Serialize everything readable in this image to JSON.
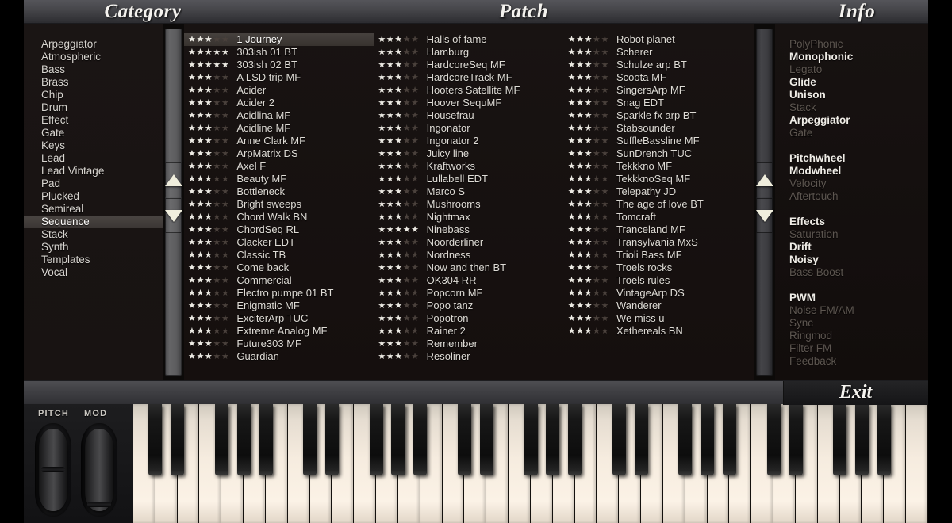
{
  "headers": {
    "category": "Category",
    "patch": "Patch",
    "info": "Info"
  },
  "categories": {
    "selected": "Sequence",
    "items": [
      "Arpeggiator",
      "Atmospheric",
      "Bass",
      "Brass",
      "Chip",
      "Drum",
      "Effect",
      "Gate",
      "Keys",
      "Lead",
      "Lead Vintage",
      "Pad",
      "Plucked",
      "Semireal",
      "Sequence",
      "Stack",
      "Synth",
      "Templates",
      "Vocal"
    ]
  },
  "patches": {
    "selected": "1 Journey",
    "max_stars": 5,
    "columns": [
      [
        {
          "name": "1 Journey",
          "stars": 3
        },
        {
          "name": "303ish 01 BT",
          "stars": 5
        },
        {
          "name": "303ish 02 BT",
          "stars": 5
        },
        {
          "name": "A LSD trip MF",
          "stars": 3
        },
        {
          "name": "Acider",
          "stars": 3
        },
        {
          "name": "Acider 2",
          "stars": 3
        },
        {
          "name": "Acidlina MF",
          "stars": 3
        },
        {
          "name": "Acidline MF",
          "stars": 3
        },
        {
          "name": "Anne Clark MF",
          "stars": 3
        },
        {
          "name": "ArpMatrix DS",
          "stars": 3
        },
        {
          "name": "Axel F",
          "stars": 3
        },
        {
          "name": "Beauty MF",
          "stars": 3
        },
        {
          "name": "Bottleneck",
          "stars": 3
        },
        {
          "name": "Bright sweeps",
          "stars": 3
        },
        {
          "name": "Chord Walk BN",
          "stars": 3
        },
        {
          "name": "ChordSeq RL",
          "stars": 3
        },
        {
          "name": "Clacker EDT",
          "stars": 3
        },
        {
          "name": "Classic TB",
          "stars": 3
        },
        {
          "name": "Come back",
          "stars": 3
        },
        {
          "name": "Commercial",
          "stars": 3
        },
        {
          "name": "Electro pumpe 01 BT",
          "stars": 3
        },
        {
          "name": "Enigmatic MF",
          "stars": 3
        },
        {
          "name": "ExciterArp TUC",
          "stars": 3
        },
        {
          "name": "Extreme Analog MF",
          "stars": 3
        },
        {
          "name": "Future303 MF",
          "stars": 3
        },
        {
          "name": "Guardian",
          "stars": 3
        }
      ],
      [
        {
          "name": "Halls of fame",
          "stars": 3
        },
        {
          "name": "Hamburg",
          "stars": 3
        },
        {
          "name": "HardcoreSeq MF",
          "stars": 3
        },
        {
          "name": "HardcoreTrack MF",
          "stars": 3
        },
        {
          "name": "Hooters Satellite MF",
          "stars": 3
        },
        {
          "name": "Hoover SequMF",
          "stars": 3
        },
        {
          "name": "Housefrau",
          "stars": 3
        },
        {
          "name": "Ingonator",
          "stars": 3
        },
        {
          "name": "Ingonator 2",
          "stars": 3
        },
        {
          "name": "Juicy line",
          "stars": 3
        },
        {
          "name": "Kraftworks",
          "stars": 3
        },
        {
          "name": "Lullabell EDT",
          "stars": 3
        },
        {
          "name": "Marco S",
          "stars": 3
        },
        {
          "name": "Mushrooms",
          "stars": 3
        },
        {
          "name": "Nightmax",
          "stars": 3
        },
        {
          "name": "Ninebass",
          "stars": 5
        },
        {
          "name": "Noorderliner",
          "stars": 3
        },
        {
          "name": "Nordness",
          "stars": 3
        },
        {
          "name": "Now and then BT",
          "stars": 3
        },
        {
          "name": "OK304 RR",
          "stars": 3
        },
        {
          "name": "Popcorn MF",
          "stars": 3
        },
        {
          "name": "Popo tanz",
          "stars": 3
        },
        {
          "name": "Popotron",
          "stars": 3
        },
        {
          "name": "Rainer 2",
          "stars": 3
        },
        {
          "name": "Remember",
          "stars": 3
        },
        {
          "name": "Resoliner",
          "stars": 3
        }
      ],
      [
        {
          "name": "Robot planet",
          "stars": 3
        },
        {
          "name": "Scherer",
          "stars": 3
        },
        {
          "name": "Schulze arp BT",
          "stars": 3
        },
        {
          "name": "Scoota MF",
          "stars": 3
        },
        {
          "name": "SingersArp MF",
          "stars": 3
        },
        {
          "name": "Snag EDT",
          "stars": 3
        },
        {
          "name": "Sparkle fx arp BT",
          "stars": 3
        },
        {
          "name": "Stabsounder",
          "stars": 3
        },
        {
          "name": "SuffleBassline MF",
          "stars": 3
        },
        {
          "name": "SunDrench TUC",
          "stars": 3
        },
        {
          "name": "Tekkkno MF",
          "stars": 3
        },
        {
          "name": "TekkknoSeq MF",
          "stars": 3
        },
        {
          "name": "Telepathy JD",
          "stars": 3
        },
        {
          "name": "The age of love BT",
          "stars": 3
        },
        {
          "name": "Tomcraft",
          "stars": 3
        },
        {
          "name": "Tranceland MF",
          "stars": 3
        },
        {
          "name": "Transylvania MxS",
          "stars": 3
        },
        {
          "name": "Trioli Bass MF",
          "stars": 3
        },
        {
          "name": "Troels rocks",
          "stars": 3
        },
        {
          "name": "Troels rules",
          "stars": 3
        },
        {
          "name": "VintageArp DS",
          "stars": 3
        },
        {
          "name": "Wanderer",
          "stars": 3
        },
        {
          "name": "We miss u",
          "stars": 3
        },
        {
          "name": "Xethereals BN",
          "stars": 3
        }
      ]
    ]
  },
  "info": {
    "groups": [
      [
        {
          "label": "PolyPhonic",
          "active": false
        },
        {
          "label": "Monophonic",
          "active": true
        },
        {
          "label": "Legato",
          "active": false
        },
        {
          "label": "Glide",
          "active": true
        },
        {
          "label": "Unison",
          "active": true
        },
        {
          "label": "Stack",
          "active": false
        },
        {
          "label": "Arpeggiator",
          "active": true
        },
        {
          "label": "Gate",
          "active": false
        }
      ],
      [
        {
          "label": "Pitchwheel",
          "active": true
        },
        {
          "label": "Modwheel",
          "active": true
        },
        {
          "label": "Velocity",
          "active": false
        },
        {
          "label": "Aftertouch",
          "active": false
        }
      ],
      [
        {
          "label": "Effects",
          "active": true
        },
        {
          "label": "Saturation",
          "active": false
        },
        {
          "label": "Drift",
          "active": true
        },
        {
          "label": "Noisy",
          "active": true
        },
        {
          "label": "Bass Boost",
          "active": false
        }
      ],
      [
        {
          "label": "PWM",
          "active": true
        },
        {
          "label": "Noise FM/AM",
          "active": false
        },
        {
          "label": "Sync",
          "active": false
        },
        {
          "label": "Ringmod",
          "active": false
        },
        {
          "label": "Filter FM",
          "active": false
        },
        {
          "label": "Feedback",
          "active": false
        }
      ]
    ]
  },
  "exit": {
    "label": "Exit"
  },
  "wheels": {
    "pitch_label": "PITCH",
    "mod_label": "MOD"
  },
  "keyboard": {
    "white_key_count": 36,
    "black_key_pattern": [
      0,
      1,
      3,
      4,
      5
    ]
  },
  "colors": {
    "wood": "#8a4520",
    "panel_bg": "#181312",
    "header_bg": "#46464a",
    "text": "#dedbd5",
    "text_dim": "#5d5650",
    "star_on": "#eceae3",
    "star_off": "#4a413c",
    "selection": "#46413e",
    "white_key": "#f6ecdf",
    "black_key": "#171717"
  }
}
